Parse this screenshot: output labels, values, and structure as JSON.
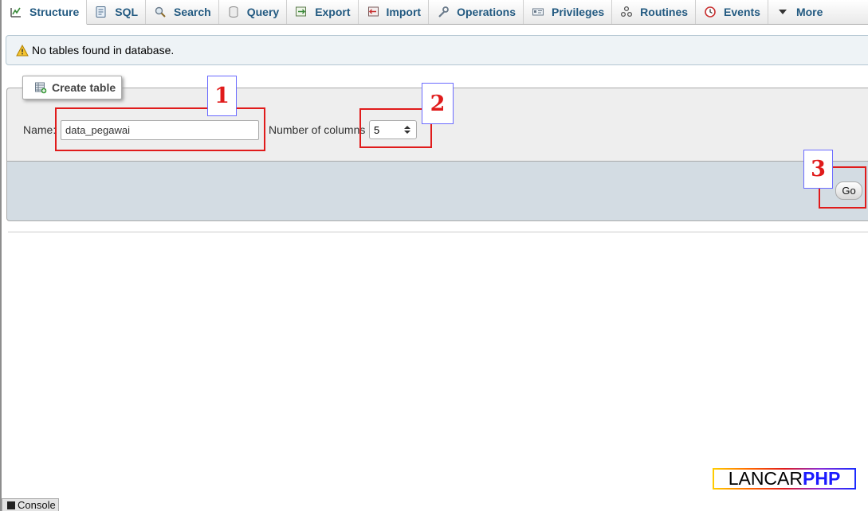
{
  "tabs": [
    {
      "label": "Structure",
      "icon": "structure-icon",
      "active": true
    },
    {
      "label": "SQL",
      "icon": "sql-icon"
    },
    {
      "label": "Search",
      "icon": "search-icon"
    },
    {
      "label": "Query",
      "icon": "query-icon"
    },
    {
      "label": "Export",
      "icon": "export-icon"
    },
    {
      "label": "Import",
      "icon": "import-icon"
    },
    {
      "label": "Operations",
      "icon": "wrench-icon"
    },
    {
      "label": "Privileges",
      "icon": "privileges-icon"
    },
    {
      "label": "Routines",
      "icon": "routines-icon"
    },
    {
      "label": "Events",
      "icon": "events-icon"
    },
    {
      "label": "More",
      "icon": "caret-down-icon"
    }
  ],
  "notice": {
    "text": "No tables found in database.",
    "icon": "warning-icon"
  },
  "create_table": {
    "legend": "Create table",
    "name_label": "Name:",
    "name_value": "data_pegawai",
    "columns_label": "Number of columns",
    "columns_value": "5",
    "go_label": "Go"
  },
  "annotations": {
    "one": "1",
    "two": "2",
    "three": "3",
    "color": "#e01b1b"
  },
  "console_label": "Console",
  "watermark": {
    "part1": "LANCAR",
    "part2": "PHP"
  },
  "colors": {
    "tab_text": "#235a81",
    "footer_bar": "#d3dce3",
    "fieldset": "#eeeeee"
  }
}
